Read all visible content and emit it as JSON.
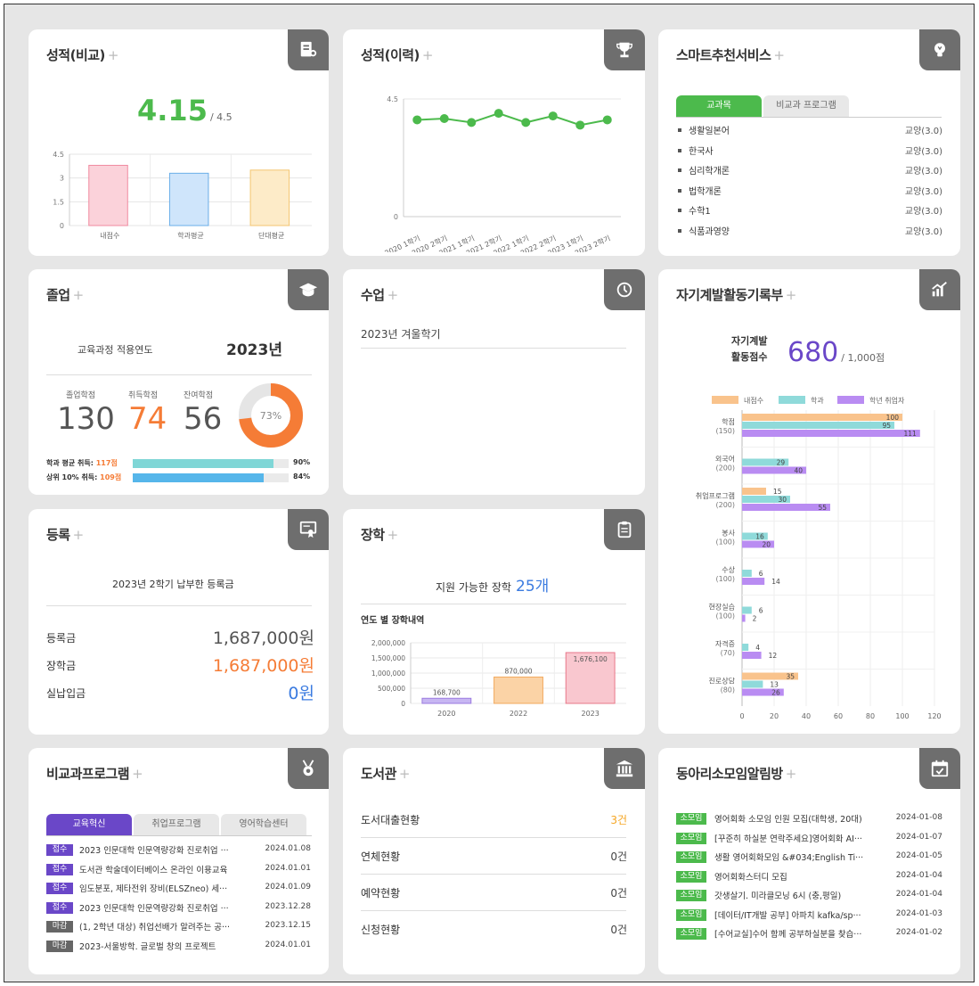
{
  "colors": {
    "green": "#4cba4c",
    "orange": "#f57c36",
    "blue": "#3b7be0",
    "purple": "#6a47c8",
    "gray": "#6e6e6e"
  },
  "grade_compare": {
    "title": "성적(비교)",
    "plus": "+",
    "icon": "report-icon",
    "score": "4.15",
    "max": "/ 4.5",
    "chart_data": {
      "type": "bar",
      "categories": [
        "내점수",
        "학과평균",
        "단대평균"
      ],
      "values": [
        3.8,
        3.3,
        3.5
      ],
      "ylim": [
        0,
        4.5
      ],
      "yticks": [
        "4.5",
        "3",
        "1.5",
        "0"
      ]
    }
  },
  "grade_history": {
    "title": "성적(이력)",
    "plus": "+",
    "icon": "trophy-icon",
    "chart_data": {
      "type": "line",
      "x": [
        "2020 1학기",
        "2020 2학기",
        "2021 1학기",
        "2021 2학기",
        "2022 1학기",
        "2022 2학기",
        "2023 1학기",
        "2023 2학기"
      ],
      "values": [
        3.7,
        3.75,
        3.6,
        3.95,
        3.6,
        3.85,
        3.5,
        3.7
      ],
      "ylim": [
        0,
        4.5
      ],
      "yticks": [
        "4.5",
        "0"
      ]
    }
  },
  "smart": {
    "title": "스마트추천서비스",
    "plus": "+",
    "icon": "lightbulb-icon",
    "tabs": [
      "교과목",
      "비교과 프로그램"
    ],
    "items": [
      {
        "name": "생활일본어",
        "type": "교양(3.0)"
      },
      {
        "name": "한국사",
        "type": "교양(3.0)"
      },
      {
        "name": "심리학개론",
        "type": "교양(3.0)"
      },
      {
        "name": "법학개론",
        "type": "교양(3.0)"
      },
      {
        "name": "수학1",
        "type": "교양(3.0)"
      },
      {
        "name": "식품과영양",
        "type": "교양(3.0)"
      }
    ]
  },
  "graduation": {
    "title": "졸업",
    "plus": "+",
    "icon": "graduation-cap-icon",
    "year_label": "교육과정 적용연도",
    "year": "2023년",
    "labels": [
      "졸업학점",
      "취득학점",
      "잔여학점"
    ],
    "values": [
      "130",
      "74",
      "56"
    ],
    "donut_pct": 73,
    "donut_label": "73%",
    "bars": [
      {
        "label": "학과 평균 취득: ",
        "value": "117점",
        "pct": 90,
        "pct_label": "90%",
        "color": "#7fd6d6"
      },
      {
        "label": "상위 10% 취득: ",
        "value": "109점",
        "pct": 84,
        "pct_label": "84%",
        "color": "#56b6ea"
      }
    ]
  },
  "class": {
    "title": "수업",
    "plus": "+",
    "icon": "clock-icon",
    "semester": "2023년 겨울학기"
  },
  "selfdev": {
    "title": "자기계발활동기록부",
    "plus": "+",
    "icon": "growth-chart-icon",
    "score_label1": "자기계발",
    "score_label2": "활동점수",
    "score": "680",
    "max": "/ 1,000점",
    "chart_data": {
      "type": "bar",
      "orientation": "horizontal",
      "series_names": [
        "내점수",
        "학과",
        "학년 취업자"
      ],
      "series_colors": [
        "#f9c38c",
        "#8fdada",
        "#b98cf2"
      ],
      "categories": [
        {
          "name": "학점",
          "sub": "(150)",
          "values": [
            100,
            95,
            111
          ]
        },
        {
          "name": "외국어",
          "sub": "(200)",
          "values": [
            null,
            29,
            40
          ]
        },
        {
          "name": "취업프로그램",
          "sub": "(200)",
          "values": [
            15,
            30,
            55
          ]
        },
        {
          "name": "봉사",
          "sub": "(100)",
          "values": [
            null,
            16,
            20
          ]
        },
        {
          "name": "수상",
          "sub": "(100)",
          "values": [
            null,
            6,
            14
          ]
        },
        {
          "name": "현장실습",
          "sub": "(100)",
          "values": [
            null,
            6,
            2
          ]
        },
        {
          "name": "자격증",
          "sub": "(70)",
          "values": [
            null,
            4,
            12
          ]
        },
        {
          "name": "진로상담",
          "sub": "(80)",
          "values": [
            35,
            13,
            26
          ]
        }
      ],
      "xlim": [
        0,
        120
      ],
      "xticks": [
        "0",
        "20",
        "40",
        "60",
        "80",
        "100",
        "120"
      ]
    }
  },
  "registration": {
    "title": "등록",
    "plus": "+",
    "icon": "certificate-icon",
    "headline": "2023년 2학기 납부한 등록금",
    "rows": [
      {
        "label": "등록금",
        "value": "1,687,000원"
      },
      {
        "label": "장학금",
        "value": "1,687,000원"
      },
      {
        "label": "실납입금",
        "value": "0원"
      }
    ]
  },
  "scholarship": {
    "title": "장학",
    "plus": "+",
    "icon": "clipboard-icon",
    "avail_label": "지원 가능한 장학",
    "avail_value": "25개",
    "sub_title": "연도 별 장학내역",
    "chart_data": {
      "type": "bar",
      "categories": [
        "2020",
        "2022",
        "2023"
      ],
      "values": [
        168700,
        870000,
        1676100
      ],
      "labels": [
        "168,700",
        "870,000",
        "1,676,100"
      ],
      "ylim": [
        0,
        2000000
      ],
      "yticks": [
        "2,000,000",
        "1,500,000",
        "1,000,000",
        "500,000",
        "0"
      ],
      "colors": [
        "#c7b6f2",
        "#fbd3a6",
        "#f9c7cf"
      ],
      "edge_colors": [
        "#9b7be0",
        "#f2a95e",
        "#e8788a"
      ]
    }
  },
  "nonsubject": {
    "title": "비교과프로그램",
    "plus": "+",
    "icon": "medal-icon",
    "tabs": [
      "교육혁신",
      "취업프로그램",
      "영어학습센터"
    ],
    "items": [
      {
        "badge": "접수",
        "text": "2023 인문대학 인문역량강화 진로취업 ···",
        "date": "2024.01.08"
      },
      {
        "badge": "접수",
        "text": "도서관 학술데이터베이스 온라인 이용교육",
        "date": "2024.01.01"
      },
      {
        "badge": "접수",
        "text": "임도분포, 제타전위 장비(ELSZneo) 세···",
        "date": "2024.01.09"
      },
      {
        "badge": "접수",
        "text": "2023 인문대학 인문역량강화 진로취업 ···",
        "date": "2023.12.28"
      },
      {
        "badge": "마감",
        "text": "(1, 2학년 대상) 취업선배가 알려주는 공···",
        "date": "2023.12.15"
      },
      {
        "badge": "마감",
        "text": "2023-서울방학. 글로벌 창의 프로젝트",
        "date": "2024.01.01"
      }
    ]
  },
  "library": {
    "title": "도서관",
    "plus": "+",
    "icon": "building-icon",
    "rows": [
      {
        "label": "도서대출현황",
        "value": "3건",
        "hl": true
      },
      {
        "label": "연체현황",
        "value": "0건"
      },
      {
        "label": "예약현황",
        "value": "0건"
      },
      {
        "label": "신청현황",
        "value": "0건"
      }
    ]
  },
  "club": {
    "title": "동아리소모임알림방",
    "plus": "+",
    "icon": "calendar-check-icon",
    "items": [
      {
        "badge": "소모임",
        "text": "영어회화 소모임 인원 모집(대학생, 20대)",
        "date": "2024-01-08"
      },
      {
        "badge": "소모임",
        "text": "[꾸준히 하실분 연락주세요]영어회화 AI···",
        "date": "2024-01-07"
      },
      {
        "badge": "소모임",
        "text": "생활 영어회화모임 &#034;English Ti···",
        "date": "2024-01-05"
      },
      {
        "badge": "소모임",
        "text": "영어회화스터디 모집",
        "date": "2024-01-04"
      },
      {
        "badge": "소모임",
        "text": "갓생살기. 미라클모닝 6시 (충,평일)",
        "date": "2024-01-04"
      },
      {
        "badge": "소모임",
        "text": "[데이터/IT개발 공부] 아파치 kafka/sp···",
        "date": "2024-01-03"
      },
      {
        "badge": "소모임",
        "text": "[수어교실]수어 함께 공부하실분을 찾습···",
        "date": "2024-01-02"
      }
    ]
  }
}
